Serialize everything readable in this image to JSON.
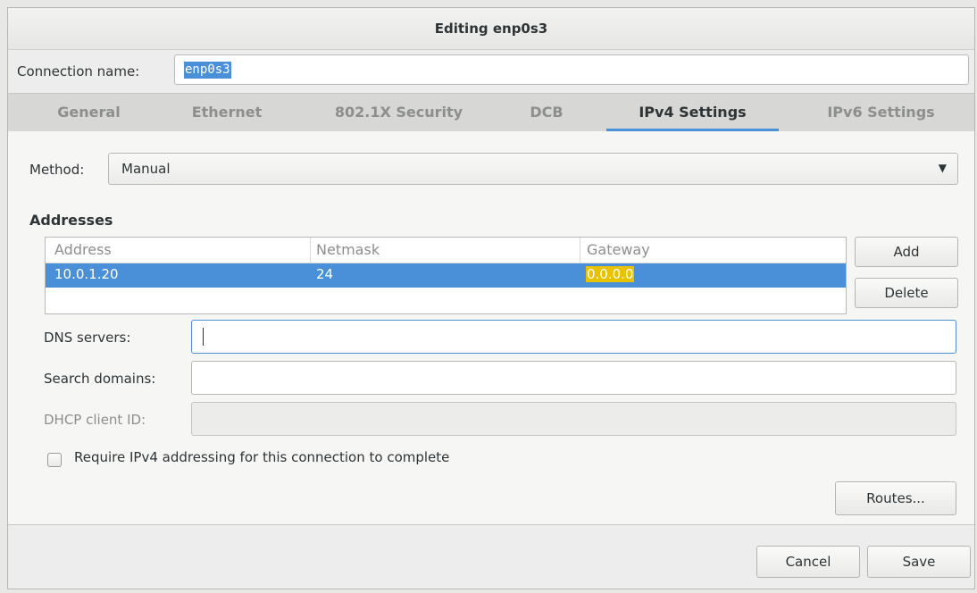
{
  "window": {
    "title": "Editing enp0s3"
  },
  "connection": {
    "label": "Connection name:",
    "value": "enp0s3"
  },
  "tabs": [
    {
      "label": "General",
      "active": false
    },
    {
      "label": "Ethernet",
      "active": false
    },
    {
      "label": "802.1X Security",
      "active": false
    },
    {
      "label": "DCB",
      "active": false
    },
    {
      "label": "IPv4 Settings",
      "active": true
    },
    {
      "label": "IPv6 Settings",
      "active": false
    }
  ],
  "method": {
    "label": "Method:",
    "value": "Manual"
  },
  "addresses": {
    "heading": "Addresses",
    "columns": [
      "Address",
      "Netmask",
      "Gateway"
    ],
    "rows": [
      {
        "address": "10.0.1.20",
        "netmask": "24",
        "gateway": "0.0.0.0"
      }
    ],
    "add_label": "Add",
    "delete_label": "Delete"
  },
  "dns": {
    "label": "DNS servers:",
    "value": ""
  },
  "search": {
    "label": "Search domains:",
    "value": ""
  },
  "dhcp": {
    "label": "DHCP client ID:",
    "value": ""
  },
  "require": {
    "label": "Require IPv4 addressing for this connection to complete",
    "checked": false
  },
  "routes_label": "Routes...",
  "footer": {
    "cancel_label": "Cancel",
    "save_label": "Save"
  },
  "colors": {
    "accent": "#4a90d9",
    "highlight": "#e8c200"
  }
}
